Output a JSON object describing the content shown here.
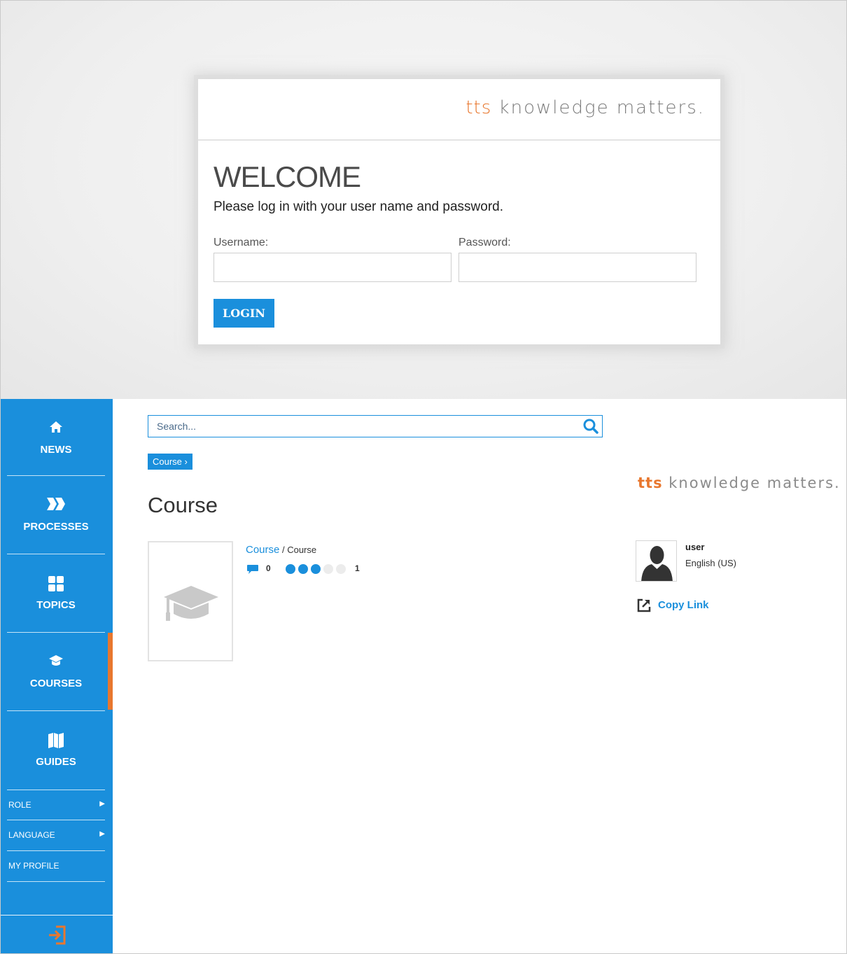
{
  "login": {
    "brand_tts": "tts",
    "brand_rest": " knowledge matters.",
    "title": "WELCOME",
    "subtitle": "Please log in with your user name and password.",
    "username_label": "Username:",
    "password_label": "Password:",
    "username_value": "",
    "password_value": "",
    "login_label": "LOGIN"
  },
  "sidebar": {
    "nav": [
      {
        "label": "NEWS",
        "icon": "home-icon"
      },
      {
        "label": "PROCESSES",
        "icon": "chevrons-right-icon"
      },
      {
        "label": "TOPICS",
        "icon": "grid-icon"
      },
      {
        "label": "COURSES",
        "icon": "graduation-cap-icon",
        "active": true
      },
      {
        "label": "GUIDES",
        "icon": "map-icon"
      }
    ],
    "sub": [
      {
        "label": "ROLE",
        "has_arrow": true
      },
      {
        "label": "LANGUAGE",
        "has_arrow": true
      },
      {
        "label": "MY PROFILE",
        "has_arrow": false
      }
    ],
    "logout_icon": "logout-icon"
  },
  "search": {
    "placeholder": "Search..."
  },
  "breadcrumb": {
    "label": "Course",
    "chevron": "›"
  },
  "main": {
    "page_title": "Course",
    "course": {
      "path_link": "Course",
      "path_sep": " / ",
      "path_current": "Course",
      "comment_count": "0",
      "rating_filled": 3,
      "rating_total": 5,
      "rating_count": "1"
    }
  },
  "right": {
    "brand_tts": "tts",
    "brand_rest": " knowledge matters.",
    "user_name": "user",
    "user_language": "English (US)",
    "copy_link_label": "Copy Link"
  },
  "colors": {
    "accent_blue": "#1a8fdc",
    "accent_orange": "#e8772e"
  }
}
